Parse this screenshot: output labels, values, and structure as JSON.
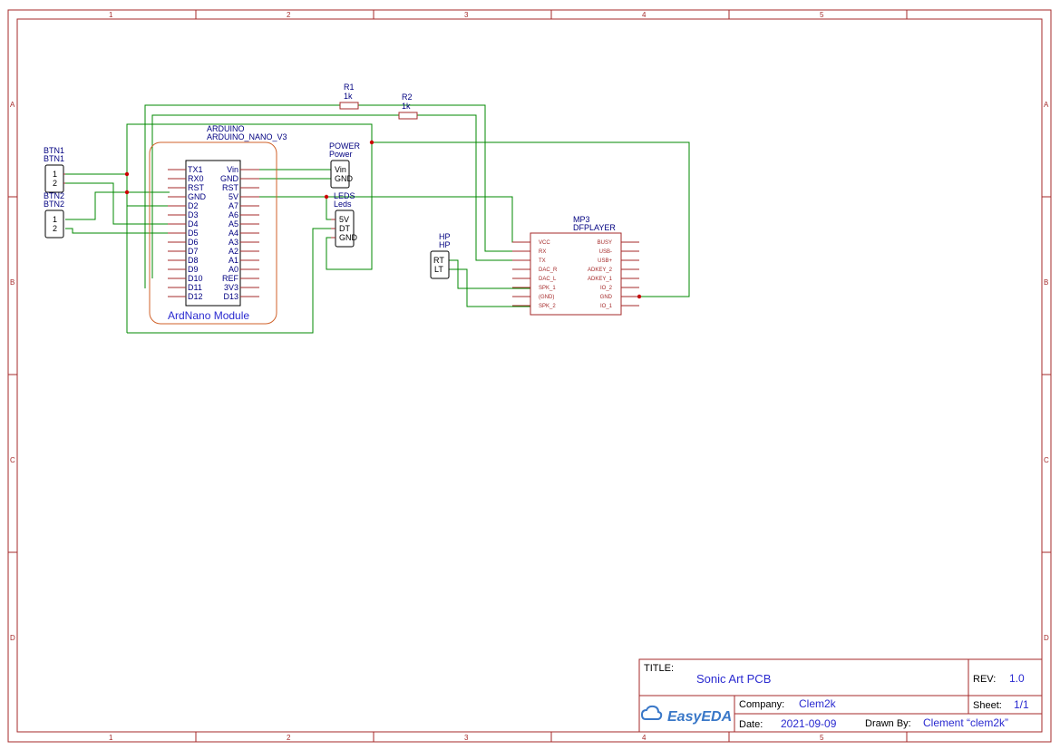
{
  "frame": {
    "column_markers": [
      "1",
      "2",
      "3",
      "4",
      "5"
    ],
    "row_markers": [
      "A",
      "B",
      "C",
      "D"
    ]
  },
  "components": {
    "r1": {
      "designator": "R1",
      "value": "1k"
    },
    "r2": {
      "designator": "R2",
      "value": "1k"
    },
    "arduino": {
      "designator": "ARDUINO",
      "part": "ARDUINO_NANO_V3",
      "module_label": "ArdNano Module",
      "left_pins": [
        "TX1",
        "RX0",
        "RST",
        "GND",
        "D2",
        "D3",
        "D4",
        "D5",
        "D6",
        "D7",
        "D8",
        "D9",
        "D10",
        "D11",
        "D12"
      ],
      "right_pins": [
        "Vin",
        "GND",
        "RST",
        "5V",
        "A7",
        "A6",
        "A5",
        "A4",
        "A3",
        "A2",
        "A1",
        "A0",
        "REF",
        "3V3",
        "D13"
      ]
    },
    "btn1": {
      "designator": "BTN1",
      "part": "BTN1",
      "pins": [
        "1",
        "2"
      ]
    },
    "btn2": {
      "designator": "BTN2",
      "part": "BTN2",
      "pins": [
        "1",
        "2"
      ]
    },
    "power": {
      "designator": "POWER",
      "part": "Power",
      "pins": [
        "Vin",
        "GND"
      ]
    },
    "leds": {
      "designator": "LEDS",
      "part": "Leds",
      "pins": [
        "5V",
        "DT",
        "GND"
      ]
    },
    "hp": {
      "designator": "HP",
      "part": "HP",
      "pins": [
        "RT",
        "LT"
      ]
    },
    "mp3": {
      "designator": "MP3",
      "part": "DFPLAYER",
      "left_pins": [
        "VCC",
        "RX",
        "TX",
        "DAC_R",
        "DAC_L",
        "SPK_1",
        "(GND)",
        "SPK_2"
      ],
      "right_pins": [
        "BUSY",
        "USB-",
        "USB+",
        "ADKEY_2",
        "ADKEY_1",
        "IO_2",
        "GND",
        "IO_1"
      ]
    }
  },
  "title_block": {
    "title_label": "TITLE:",
    "title": "Sonic Art PCB",
    "rev_label": "REV:",
    "rev": "1.0",
    "company_label": "Company:",
    "company": "Clem2k",
    "sheet_label": "Sheet:",
    "sheet": "1/1",
    "date_label": "Date:",
    "date": "2021-09-09",
    "drawn_by_label": "Drawn By:",
    "drawn_by": "Clement “clem2k”",
    "logo": "EasyEDA"
  }
}
